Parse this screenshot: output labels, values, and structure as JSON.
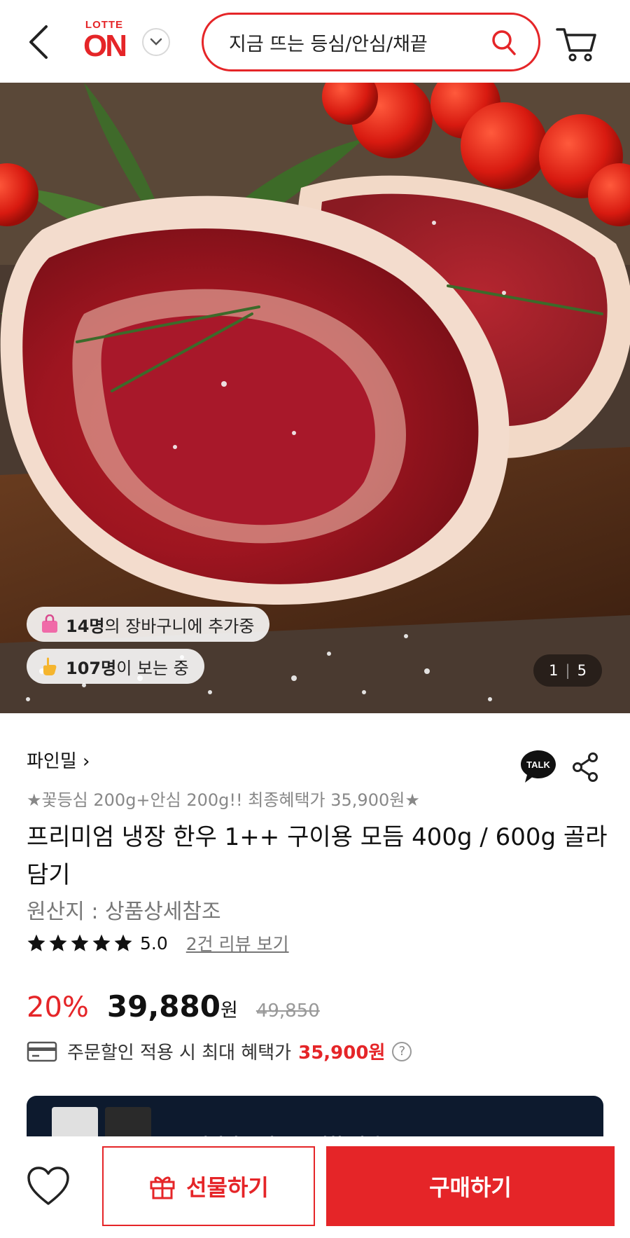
{
  "header": {
    "logo_top": "LOTTE",
    "logo_main": "ON",
    "search_text": "지금 뜨는 등심/안심/채끝"
  },
  "hero": {
    "cart_chip": {
      "num": "14명",
      "text": "의 장바구니에 추가중"
    },
    "view_chip": {
      "num": "107명",
      "text": "이 보는 중"
    },
    "counter": {
      "current": "1",
      "total": "5"
    }
  },
  "product": {
    "seller": "파인밀 ›",
    "promo": "★꽃등심 200g+안심 200g!! 최종혜택가 35,900원★",
    "title": "프리미엄 냉장 한우 1++ 구이용 모듬 400g / 600g 골라담기",
    "origin": "원산지 : 상품상세참조",
    "rating": 5,
    "rating_text": "5.0",
    "reviews": "2건 리뷰 보기",
    "discount": "20%",
    "price": "39,880",
    "price_unit": "원",
    "original_price": "49,850",
    "benefit_label": "주문할인 적용 시 최대 혜택가",
    "benefit_amount": "35,900원",
    "talk_label": "TALK"
  },
  "banner": {
    "text": "롯데멤버스 카드 풍성한 혜택"
  },
  "bottom": {
    "gift_label": "선물하기",
    "buy_label": "구매하기"
  },
  "colors": {
    "accent": "#e52528",
    "banner_bg": "#0d1a2e"
  }
}
